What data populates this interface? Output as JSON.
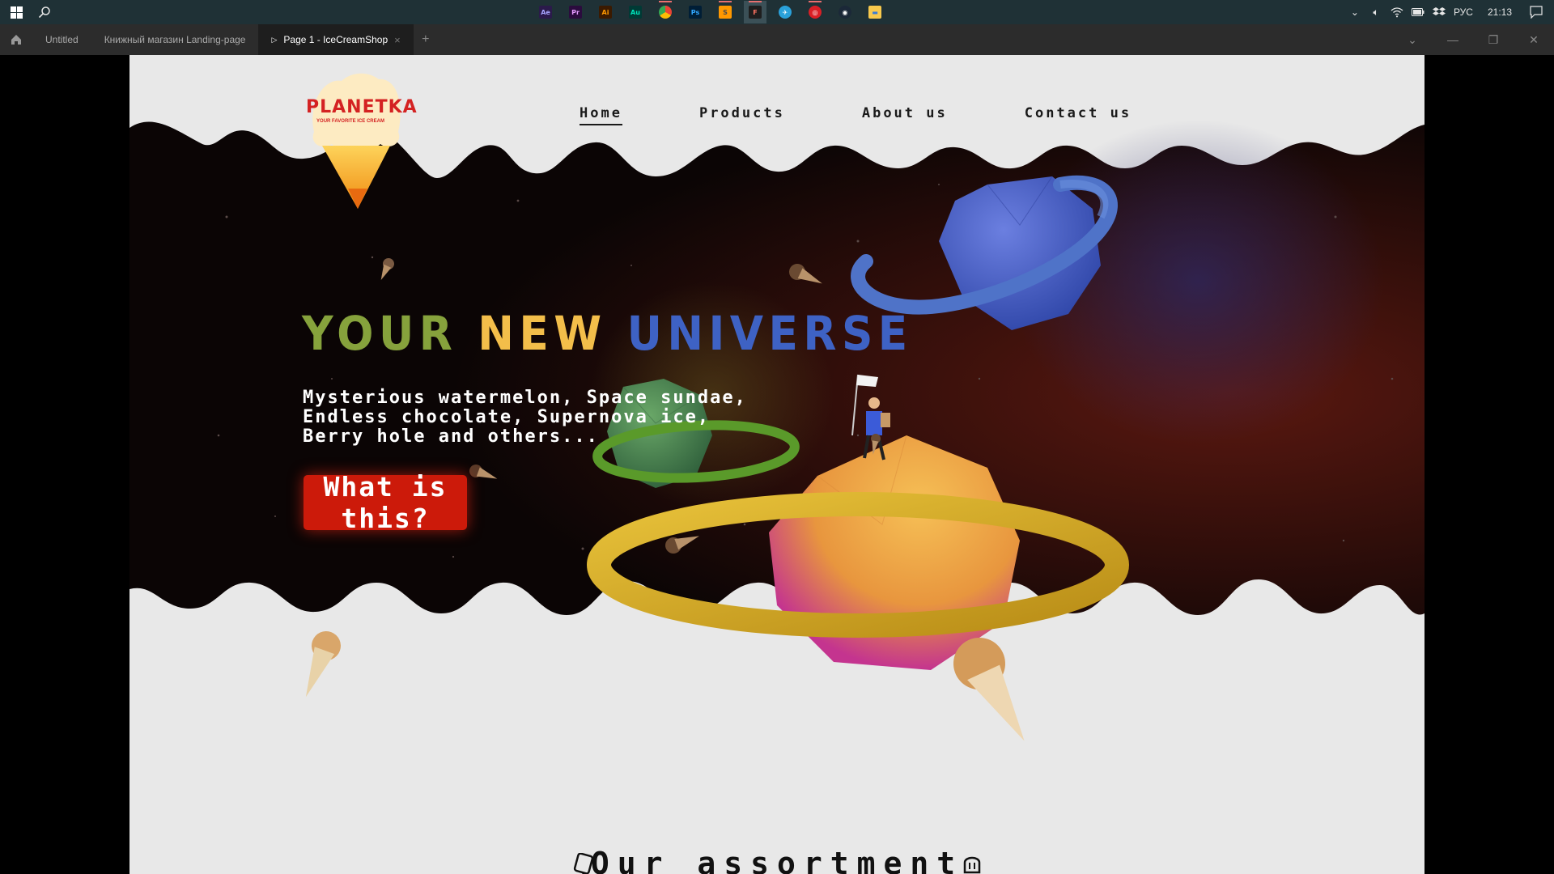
{
  "taskbar": {
    "apps": [
      {
        "name": "after-effects",
        "abbr": "Ae",
        "bg": "#2b1a4b",
        "fg": "#a7a5ff"
      },
      {
        "name": "premiere",
        "abbr": "Pr",
        "bg": "#2b0b3e",
        "fg": "#e59bff"
      },
      {
        "name": "illustrator",
        "abbr": "Ai",
        "bg": "#3b1a00",
        "fg": "#ff9a00"
      },
      {
        "name": "audition",
        "abbr": "Au",
        "bg": "#003a35",
        "fg": "#00e4bb"
      },
      {
        "name": "chrome",
        "abbr": "",
        "bg": "#ffffff",
        "fg": "#ffffff"
      },
      {
        "name": "photoshop",
        "abbr": "Ps",
        "bg": "#001e36",
        "fg": "#31a8ff"
      },
      {
        "name": "sublime",
        "abbr": "S",
        "bg": "#ff9800",
        "fg": "#4a4a4a"
      },
      {
        "name": "figma",
        "abbr": "F",
        "bg": "#1e1e1e",
        "fg": "#ff7262"
      },
      {
        "name": "telegram",
        "abbr": "✈",
        "bg": "#2aa1da",
        "fg": "#ffffff"
      },
      {
        "name": "creative-cloud",
        "abbr": "◎",
        "bg": "#da1f26",
        "fg": "#ffffff"
      },
      {
        "name": "steam",
        "abbr": "◉",
        "bg": "#1b2838",
        "fg": "#ffffff"
      },
      {
        "name": "file-explorer",
        "abbr": "▬",
        "bg": "#f8c94d",
        "fg": "#3a7bd5"
      }
    ],
    "lang": "РУС",
    "time": "21:13"
  },
  "tabs": [
    {
      "label": "Untitled"
    },
    {
      "label": "Книжный магазин Landing-page"
    },
    {
      "label": "Page 1 - IceCreamShop"
    }
  ],
  "site": {
    "logo_title": "PLANETKA",
    "logo_tagline": "YOUR FAVORITE ICE CREAM",
    "nav": [
      "Home",
      "Products",
      "About us",
      "Contact us"
    ],
    "headline": {
      "w1": "YOUR",
      "w2": "NEW",
      "w3": "UNIVERSE"
    },
    "subtitle": [
      "Mysterious watermelon, Space sundae,",
      "Endless chocolate, Supernova ice,",
      "Berry hole and others..."
    ],
    "cta": "What is this?",
    "section_title": "Our assortment"
  },
  "colors": {
    "headline_green": "#86a23c",
    "headline_yellow": "#f3be4a",
    "headline_blue": "#3e62c4",
    "cta_red": "#cc1a0a",
    "logo_red": "#d42222"
  }
}
